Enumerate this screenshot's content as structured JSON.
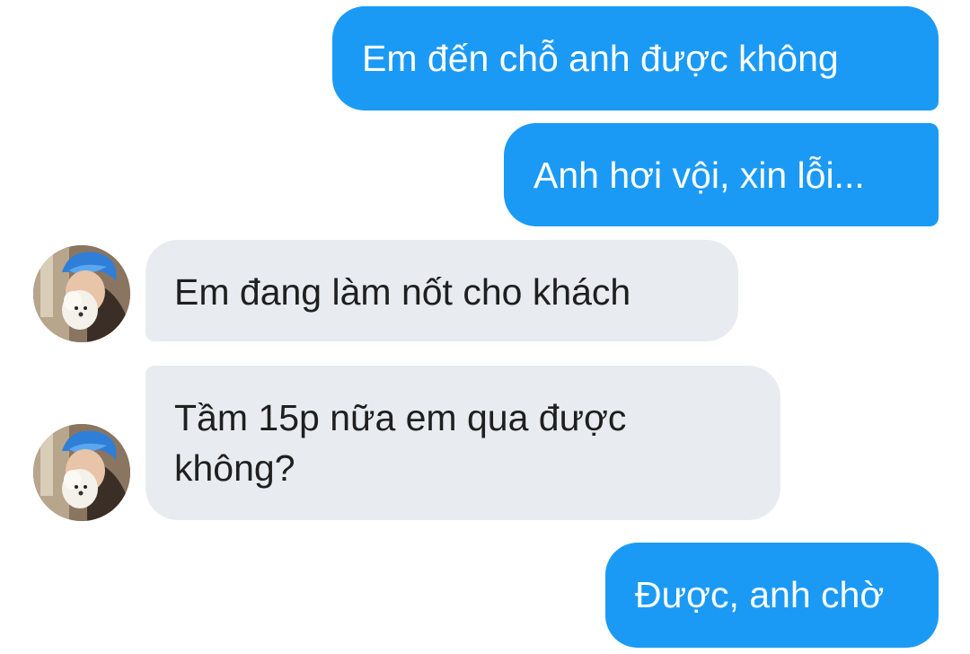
{
  "messages": [
    {
      "id": "m1",
      "direction": "outgoing",
      "text": "Em đến chỗ anh được không"
    },
    {
      "id": "m2",
      "direction": "outgoing",
      "text": "Anh hơi vội, xin lỗi..."
    },
    {
      "id": "m3",
      "direction": "incoming",
      "text": "Em đang làm nốt cho khách"
    },
    {
      "id": "m4",
      "direction": "incoming",
      "text": "Tầm 15p nữa em qua được\nkhông?"
    },
    {
      "id": "m5",
      "direction": "outgoing",
      "text": "Được, anh chờ"
    }
  ],
  "colors": {
    "outgoing_bubble": "#1b9af5",
    "incoming_bubble": "#e8ebef",
    "incoming_text": "#1f1f1f",
    "background": "#ffffff"
  },
  "avatar": {
    "icon": "contact-avatar-photo"
  }
}
